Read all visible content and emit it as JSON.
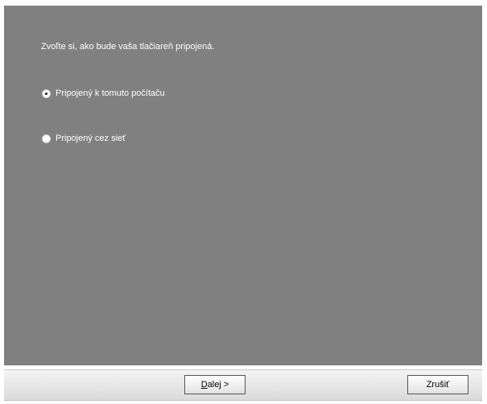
{
  "wizard": {
    "prompt": "Zvoľte si, ako bude vaša tlačiareň pripojená.",
    "options": [
      {
        "label": "Pripojený k tomuto počítaču",
        "selected": true
      },
      {
        "label": "Pripojený cez sieť",
        "selected": false
      }
    ]
  },
  "buttons": {
    "next_underlined": "D",
    "next_rest": "alej >",
    "cancel": "Zrušiť"
  }
}
